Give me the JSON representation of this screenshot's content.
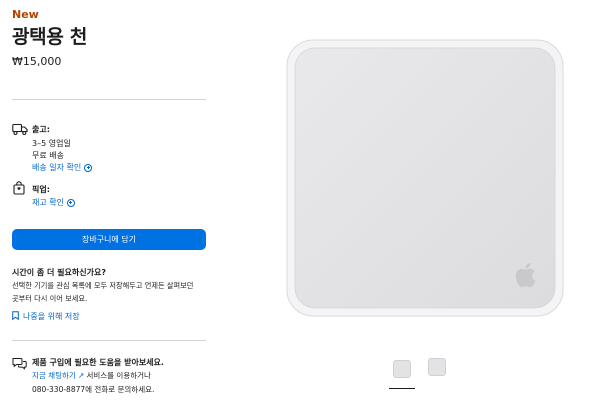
{
  "product": {
    "badge": "New",
    "title": "광택용 천",
    "price": "₩15,000"
  },
  "shipping": {
    "icon": "truck-icon",
    "label": "출고:",
    "lead_time": "3–5 영업일",
    "cost": "무료 배송",
    "link": "배송 일자 확인"
  },
  "pickup": {
    "icon": "store-bag-icon",
    "label": "픽업:",
    "link": "재고 확인"
  },
  "cart_button": "장바구니에 담기",
  "save_for_later": {
    "heading": "시간이 좀 더 필요하신가요?",
    "text_line1": "선택한 기기를 관심 목록에 모두 저장해두고 언제든 살펴보던",
    "text_line2": "곳부터 다시 이어 보세요.",
    "link": "나중을 위해 저장",
    "icon": "bookmark-icon"
  },
  "help": {
    "icon": "chat-bubbles-icon",
    "heading": "제품 구입에 필요한 도움을 받아보세요.",
    "chat_link": "지금 채팅하기 ↗",
    "line1_rest": "서비스를 이용하거나",
    "line2": "080-330-8877에 전화로 문의하세요."
  },
  "gallery": {
    "logo": "apple-logo-icon",
    "thumbnails": [
      "thumbnail-1",
      "thumbnail-2"
    ],
    "selected_index": 0
  },
  "colors": {
    "accent": "#0071e3",
    "link": "#0066cc",
    "new_badge": "#b64400",
    "cloth": "#e6e6e8"
  }
}
